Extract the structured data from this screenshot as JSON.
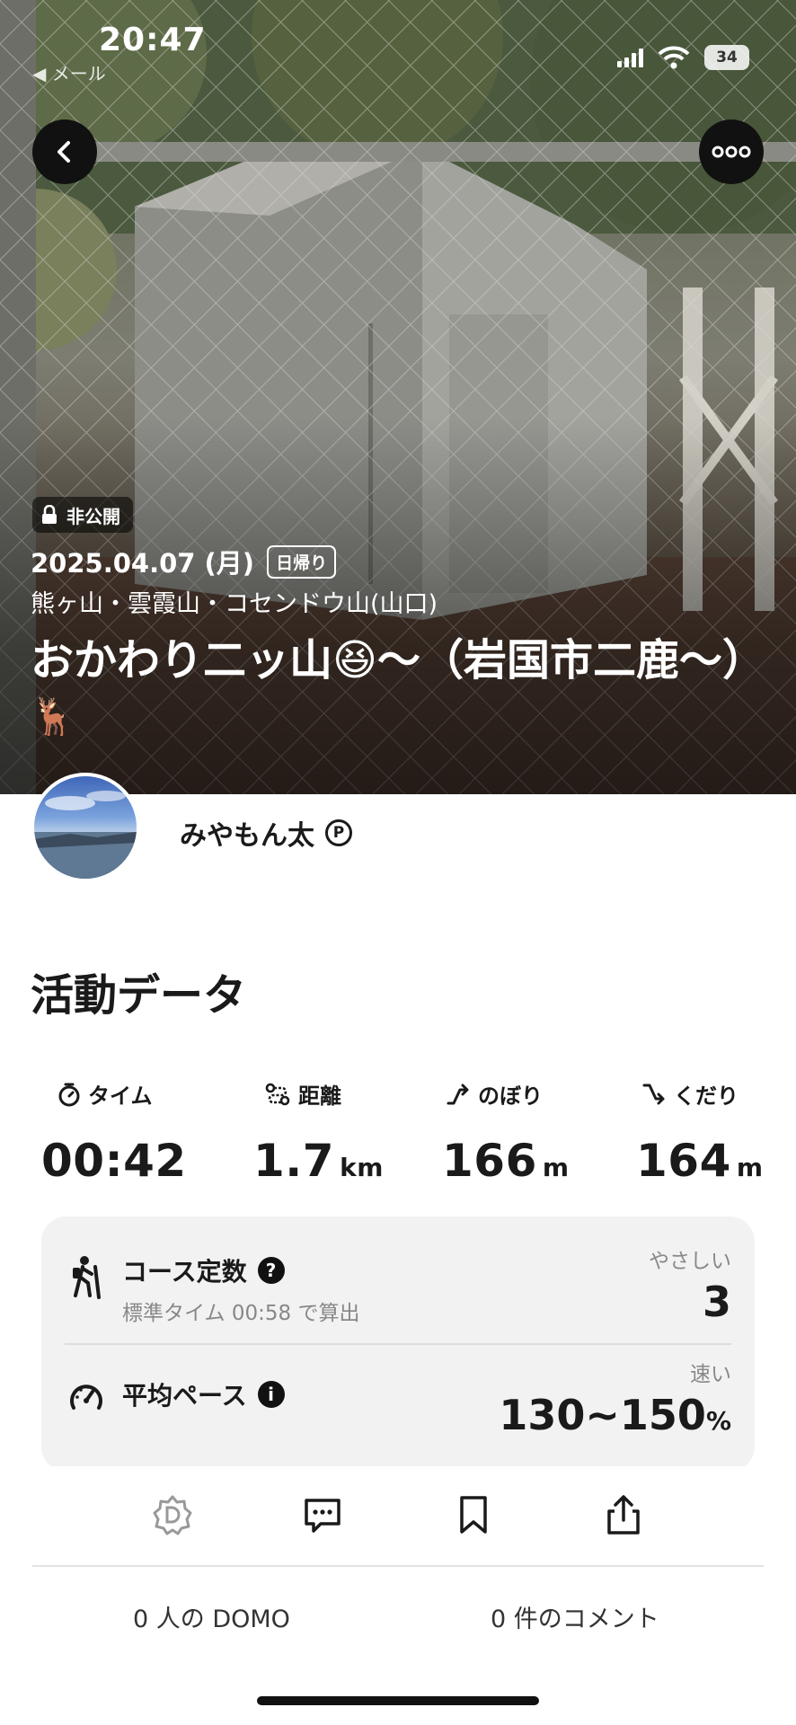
{
  "status_bar": {
    "time": "20:47",
    "back_app": "◀ メール",
    "battery": "34"
  },
  "activity": {
    "visibility": "非公開",
    "date": "2025.04.07 (月)",
    "trip_type": "日帰り",
    "mountains": "熊ヶ山・雲霞山・コセンドウ山(山口)",
    "title": "おかわり二ッ山😆〜（岩国市二鹿〜）",
    "title_suffix_emoji": "🦌"
  },
  "user": {
    "name": "みやもん太",
    "badge": "P"
  },
  "section_title": "活動データ",
  "stats": [
    {
      "label": "タイム",
      "value": "00:42",
      "unit": "",
      "icon": "stopwatch-icon"
    },
    {
      "label": "距離",
      "value": "1.7",
      "unit": "km",
      "icon": "route-icon"
    },
    {
      "label": "のぼり",
      "value": "166",
      "unit": "m",
      "icon": "ascent-icon"
    },
    {
      "label": "くだり",
      "value": "164",
      "unit": "m",
      "icon": "descent-icon"
    }
  ],
  "course_constant": {
    "label": "コース定数",
    "sub": "標準タイム 00:58 で算出",
    "rating": "やさしい",
    "value": "3"
  },
  "avg_pace": {
    "label": "平均ペース",
    "rating": "速い",
    "value": "130~150",
    "unit": "%"
  },
  "footer": {
    "domo_count": "0 人の DOMO",
    "comment_count": "0 件のコメント"
  }
}
